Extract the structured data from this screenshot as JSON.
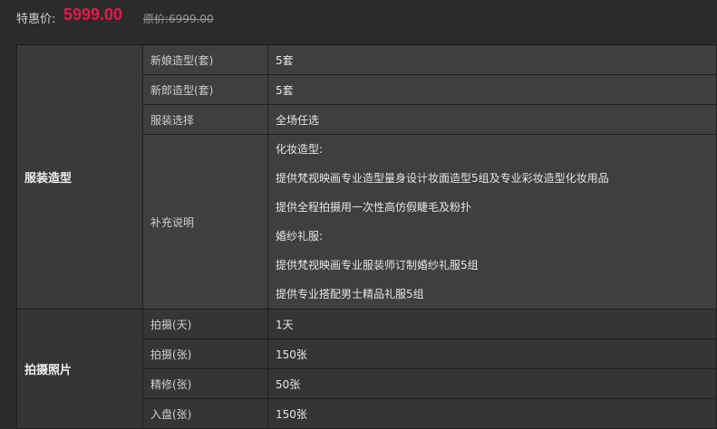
{
  "price": {
    "label": "特惠价:",
    "value": "5999.00",
    "original": "原价:6999.00"
  },
  "groups": [
    {
      "title": "服装造型",
      "rows": [
        {
          "label": "新娘造型(套)",
          "value": "5套"
        },
        {
          "label": "新郎造型(套)",
          "value": "5套"
        },
        {
          "label": "服装选择",
          "value": "全场任选"
        },
        {
          "label": "补充说明",
          "lines": [
            "化妆造型:",
            "提供梵视映画专业造型量身设计妆面造型5组及专业彩妆造型化妆用品",
            "提供全程拍摄用一次性高仿假睫毛及粉扑",
            "婚纱礼服:",
            "提供梵视映画专业服装师订制婚纱礼服5组",
            "提供专业搭配男士精品礼服5组"
          ]
        }
      ]
    },
    {
      "title": "拍摄照片",
      "rows": [
        {
          "label": "拍摄(天)",
          "value": "1天"
        },
        {
          "label": "拍摄(张)",
          "value": "150张"
        },
        {
          "label": "精修(张)",
          "value": "50张"
        },
        {
          "label": "入盘(张)",
          "value": "150张"
        }
      ]
    }
  ]
}
